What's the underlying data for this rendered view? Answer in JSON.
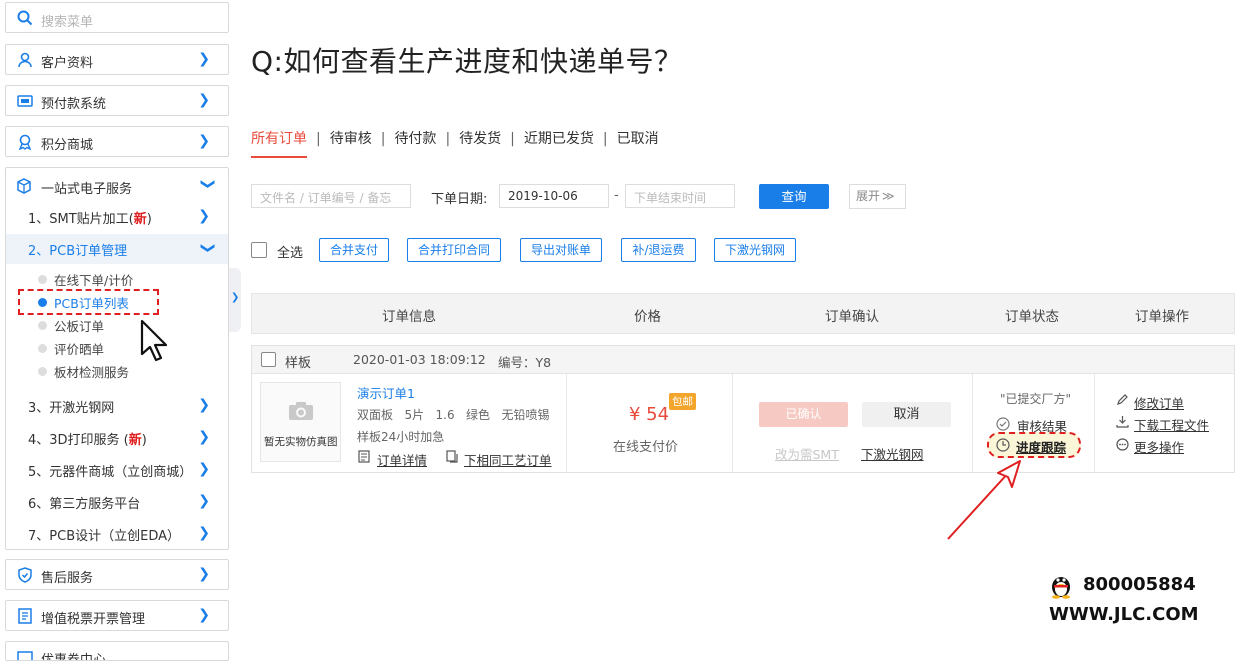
{
  "sidebar": {
    "search_placeholder": "搜索菜单",
    "items_top": [
      {
        "label": "客户资料",
        "icon": "user-icon"
      },
      {
        "label": "预付款系统",
        "icon": "prepay-icon"
      },
      {
        "label": "积分商城",
        "icon": "points-icon"
      }
    ],
    "expanded": {
      "label": "一站式电子服务",
      "icon": "box-icon",
      "children": [
        {
          "label": "1、SMT贴片加工(",
          "badge": "新",
          "tail": ")"
        },
        {
          "label": "2、PCB订单管理",
          "active": true
        },
        {
          "label": "3、开激光钢网"
        },
        {
          "label": "4、3D打印服务 (",
          "badge": "新",
          "tail": ")"
        },
        {
          "label": "5、元器件商城（立创商城）"
        },
        {
          "label": "6、第三方服务平台"
        },
        {
          "label": "7、PCB设计（立创EDA）"
        }
      ],
      "pcb_children": [
        "在线下单/计价",
        "PCB订单列表",
        "公板订单",
        "评价晒单",
        "板材检测服务"
      ]
    },
    "items_bottom": [
      {
        "label": "售后服务",
        "icon": "shield-icon"
      },
      {
        "label": "增值税票开票管理",
        "icon": "invoice-icon"
      },
      {
        "label": "优惠券中心",
        "icon": "coupon-icon"
      }
    ]
  },
  "main": {
    "title": "Q:如何查看生产进度和快递单号？",
    "tabs": [
      "所有订单",
      "待审核",
      "待付款",
      "待发货",
      "近期已发货",
      "已取消"
    ],
    "filter": {
      "keyword_placeholder": "文件名 / 订单编号 / 备忘",
      "date_label": "下单日期:",
      "date_start": "2019-10-06",
      "date_sep": "-",
      "date_end_placeholder": "下单结束时间",
      "query": "查询",
      "expand": "展开"
    },
    "actions": {
      "select_all": "全选",
      "buttons": [
        "合并支付",
        "合并打印合同",
        "导出对账单",
        "补/退运费",
        "下激光钢网"
      ]
    },
    "table_headers": [
      "订单信息",
      "价格",
      "订单确认",
      "订单状态",
      "订单操作"
    ],
    "order": {
      "type": "样板",
      "time": "2020-01-03 18:09:12",
      "number": "编号：Y8",
      "thumb_text": "暂无实物仿真图",
      "name": "演示订单1",
      "spec": "双面板   5片   1.6   绿色   无铅喷锡",
      "spec2": "样板24小时加急",
      "detail_link": "订单详情",
      "same_link": "下相同工艺订单",
      "price": "¥ 54",
      "price_badge": "包邮",
      "pay_method": "在线支付价",
      "confirm_btn": "已确认",
      "cancel_btn": "取消",
      "smt_link": "改为需SMT",
      "stencil_link": "下激光钢网",
      "status": "\"已提交厂方\"",
      "audit": "审核结果",
      "progress": "进度跟踪",
      "ops": [
        "修改订单",
        "下载工程文件",
        "更多操作"
      ]
    },
    "qq": {
      "number": "800005884",
      "site": "WWW.JLC.COM"
    },
    "colors": {
      "accent_blue": "#1a7ee8",
      "accent_red": "#e84b3c",
      "annotation_red": "#e02020"
    }
  }
}
